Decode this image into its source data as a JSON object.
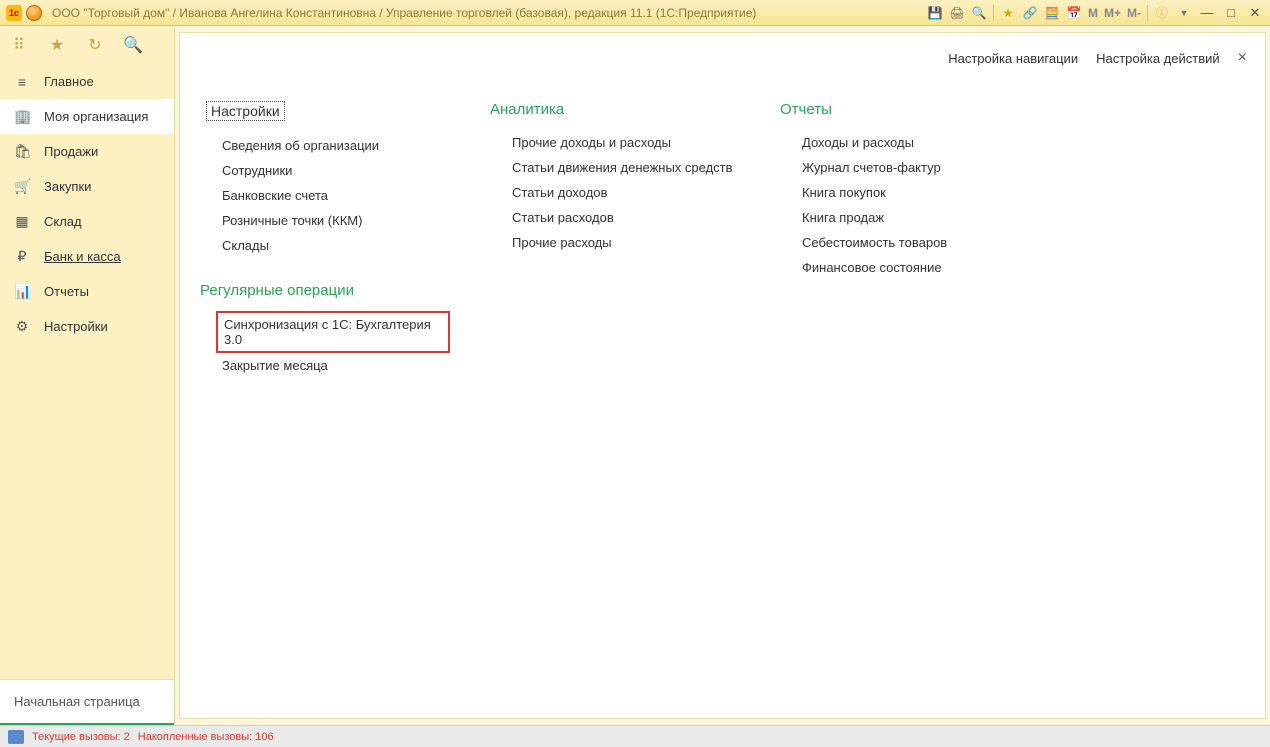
{
  "titlebar": {
    "logo_text": "1c",
    "title": "ООО \"Торговый дом\" / Иванова Ангелина Константиновна / Управление торговлей (базовая), редакция 11.1  (1С:Предприятие)",
    "calc_m": "M",
    "calc_mplus": "M+",
    "calc_mminus": "M-"
  },
  "sidebar": {
    "items": [
      {
        "icon": "≡",
        "label": "Главное"
      },
      {
        "icon": "🏢",
        "label": "Моя организация"
      },
      {
        "icon": "🛍",
        "label": "Продажи"
      },
      {
        "icon": "🛒",
        "label": "Закупки"
      },
      {
        "icon": "▦",
        "label": "Склад"
      },
      {
        "icon": "₽",
        "label": "Банк и касса"
      },
      {
        "icon": "📊",
        "label": "Отчеты"
      },
      {
        "icon": "⚙",
        "label": "Настройки"
      }
    ],
    "bottom_tab": "Начальная страница"
  },
  "content": {
    "header": {
      "nav_settings": "Настройка навигации",
      "actions_settings": "Настройка действий"
    },
    "columns": {
      "settings": {
        "title": "Настройки",
        "links": [
          "Сведения об организации",
          "Сотрудники",
          "Банковские счета",
          "Розничные точки (ККМ)",
          "Склады"
        ]
      },
      "regular_ops": {
        "title": "Регулярные операции",
        "links": [
          "Синхронизация с 1С: Бухгалтерия 3.0",
          "Закрытие месяца"
        ]
      },
      "analytics": {
        "title": "Аналитика",
        "links": [
          "Прочие доходы и расходы",
          "Статьи движения денежных средств",
          "Статьи доходов",
          "Статьи расходов",
          "Прочие расходы"
        ]
      },
      "reports": {
        "title": "Отчеты",
        "links": [
          "Доходы и расходы",
          "Журнал счетов-фактур",
          "Книга покупок",
          "Книга продаж",
          "Себестоимость товаров",
          "Финансовое состояние"
        ]
      }
    }
  },
  "statusbar": {
    "current_calls": "Текущие вызовы: 2",
    "accumulated_calls": "Накопленные вызовы: 106"
  }
}
